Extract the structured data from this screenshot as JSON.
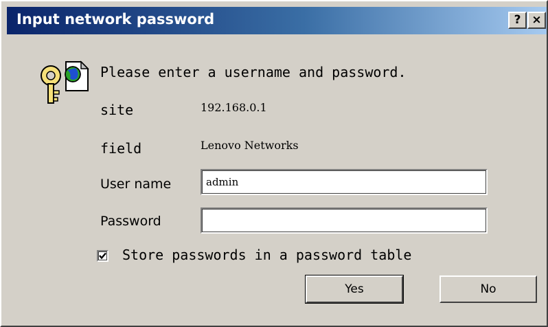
{
  "window": {
    "title": "Input network password",
    "help_button": "?",
    "close_button": "×"
  },
  "dialog": {
    "prompt": "Please enter a username and password.",
    "site_label": "site",
    "site_value": "192.168.0.1",
    "field_label": "field",
    "field_value": "Lenovo Networks",
    "username_label": "User name",
    "username_value": "admin",
    "password_label": "Password",
    "password_value": "",
    "store_checkbox_label": "Store passwords in a password table",
    "store_checked": true,
    "yes_label": "Yes",
    "no_label": "No",
    "icon": "key-globe-icon"
  },
  "colors": {
    "dialog_face": "#d4d0c8",
    "title_start": "#0a246a",
    "title_end": "#a6caf0"
  }
}
